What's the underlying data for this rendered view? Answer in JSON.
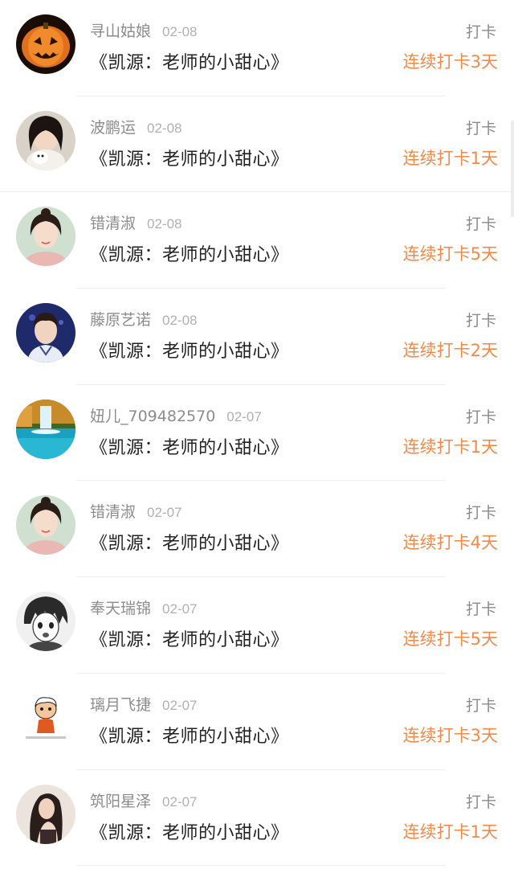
{
  "rows": [
    {
      "name": "寻山姑娘",
      "date": "02-08",
      "title": "《凯源：老师的小甜心》",
      "action": "打卡",
      "streak": "连续打卡3天",
      "avatar": "pumpkin-avatar"
    },
    {
      "name": "波鹏运",
      "date": "02-08",
      "title": "《凯源：老师的小甜心》",
      "action": "打卡",
      "streak": "连续打卡1天",
      "avatar": "girl-with-puppy-avatar"
    },
    {
      "name": "错清淑",
      "date": "02-08",
      "title": "《凯源：老师的小甜心》",
      "action": "打卡",
      "streak": "连续打卡5天",
      "avatar": "girl-portrait-avatar"
    },
    {
      "name": "藤原艺诺",
      "date": "02-08",
      "title": "《凯源：老师的小甜心》",
      "action": "打卡",
      "streak": "连续打卡2天",
      "avatar": "boy-portrait-avatar"
    },
    {
      "name": "妞儿_709482570",
      "date": "02-07",
      "title": "《凯源：老师的小甜心》",
      "action": "打卡",
      "streak": "连续打卡1天",
      "avatar": "waterfall-lake-avatar"
    },
    {
      "name": "错清淑",
      "date": "02-07",
      "title": "《凯源：老师的小甜心》",
      "action": "打卡",
      "streak": "连续打卡4天",
      "avatar": "girl-portrait-avatar"
    },
    {
      "name": "奉天瑞锦",
      "date": "02-07",
      "title": "《凯源：老师的小甜心》",
      "action": "打卡",
      "streak": "连续打卡5天",
      "avatar": "anime-boy-avatar"
    },
    {
      "name": "璃月飞捷",
      "date": "02-07",
      "title": "《凯源：老师的小甜心》",
      "action": "打卡",
      "streak": "连续打卡3天",
      "avatar": "cartoon-figure-avatar"
    },
    {
      "name": "筑阳星泽",
      "date": "02-07",
      "title": "《凯源：老师的小甜心》",
      "action": "打卡",
      "streak": "连续打卡1天",
      "avatar": "girl-photo-avatar"
    }
  ]
}
